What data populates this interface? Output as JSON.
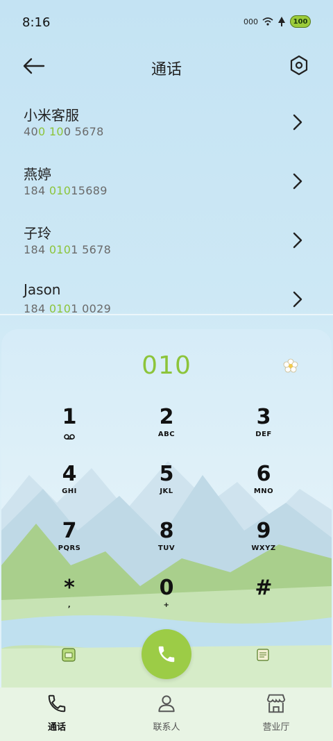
{
  "status_bar": {
    "time": "8:16",
    "signal_text": "000",
    "battery": "100"
  },
  "header": {
    "title": "通话"
  },
  "contacts": [
    {
      "name": "小米客服",
      "number_parts": [
        "40",
        "0",
        " ",
        "10",
        "0 5678"
      ]
    },
    {
      "name": "燕婷",
      "number_parts": [
        "184 ",
        "010",
        "15689"
      ]
    },
    {
      "name": "子玲",
      "number_parts": [
        "184 ",
        "010",
        "1 5678"
      ]
    },
    {
      "name": "Jason",
      "number_parts": [
        "184 ",
        "010",
        "1 0029"
      ]
    }
  ],
  "dialer": {
    "input": "010",
    "keys": [
      {
        "digit": "1",
        "letters": ""
      },
      {
        "digit": "2",
        "letters": "ABC"
      },
      {
        "digit": "3",
        "letters": "DEF"
      },
      {
        "digit": "4",
        "letters": "GHI"
      },
      {
        "digit": "5",
        "letters": "JKL"
      },
      {
        "digit": "6",
        "letters": "MNO"
      },
      {
        "digit": "7",
        "letters": "PQRS"
      },
      {
        "digit": "8",
        "letters": "TUV"
      },
      {
        "digit": "9",
        "letters": "WXYZ"
      },
      {
        "digit": "*",
        "letters": ","
      },
      {
        "digit": "0",
        "letters": "+"
      },
      {
        "digit": "#",
        "letters": ""
      }
    ]
  },
  "nav": {
    "calls": "通话",
    "contacts": "联系人",
    "store": "营业厅"
  },
  "colors": {
    "accent": "#8cc43a",
    "call_button": "#9ccc46"
  }
}
